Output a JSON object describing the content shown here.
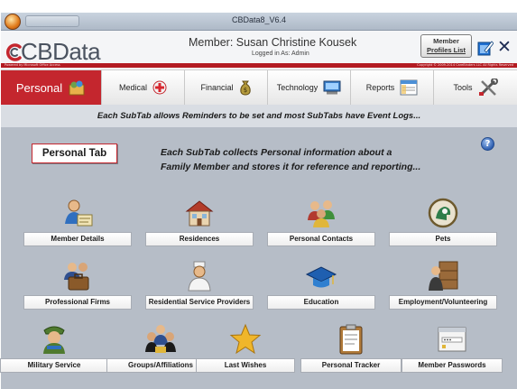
{
  "window": {
    "title": "CBData8_V6.4"
  },
  "header": {
    "brand_c": "C",
    "brand_rest": "CBData",
    "member_text": "Member:  Susan Christine Kousek",
    "logged_in": "Logged in As:  Admin",
    "small_left": "Powered by Microsoft Office Access",
    "small_right": "Copyright © 2009-2014 CareBinders LLC  All Rights Reserved",
    "member_profiles_line1": "Member",
    "member_profiles_line2": "Profiles List"
  },
  "tabs": [
    {
      "label": "Personal",
      "icon": "personal-icon",
      "active": true
    },
    {
      "label": "Medical",
      "icon": "medical-cross-icon",
      "active": false
    },
    {
      "label": "Financial",
      "icon": "money-bag-icon",
      "active": false
    },
    {
      "label": "Technology",
      "icon": "computer-icon",
      "active": false
    },
    {
      "label": "Reports",
      "icon": "report-sheet-icon",
      "active": false
    },
    {
      "label": "Tools",
      "icon": "tools-icon",
      "active": false
    }
  ],
  "info_bar": "Each SubTab allows Reminders to be set and most SubTabs have Event Logs...",
  "personal_tab": {
    "label": "Personal Tab",
    "description_line1": "Each SubTab collects Personal information about a",
    "description_line2": "Family Member and stores it for reference and reporting..."
  },
  "help_glyph": "?",
  "subtabs": [
    {
      "label": "Member Details",
      "icon": "member-details-icon"
    },
    {
      "label": "Residences",
      "icon": "house-icon"
    },
    {
      "label": "Personal Contacts",
      "icon": "contacts-icon"
    },
    {
      "label": "Pets",
      "icon": "pets-icon"
    },
    {
      "label": "Professional Firms",
      "icon": "briefcase-icon"
    },
    {
      "label": "Residential Service Providers",
      "icon": "service-person-icon"
    },
    {
      "label": "Education",
      "icon": "graduation-cap-icon"
    },
    {
      "label": "Employment/Volunteering",
      "icon": "office-worker-icon"
    },
    {
      "label": "Military Service",
      "icon": "military-icon"
    },
    {
      "label": "Groups/Affiliations",
      "icon": "group-icon"
    },
    {
      "label": "Last Wishes",
      "icon": "star-icon"
    },
    {
      "label": "Personal Tracker",
      "icon": "clipboard-icon"
    },
    {
      "label": "Member Passwords",
      "icon": "password-window-icon"
    }
  ],
  "colors": {
    "brand_red": "#c4262e",
    "panel": "#b6bdc7",
    "navy": "#1d2b52"
  }
}
